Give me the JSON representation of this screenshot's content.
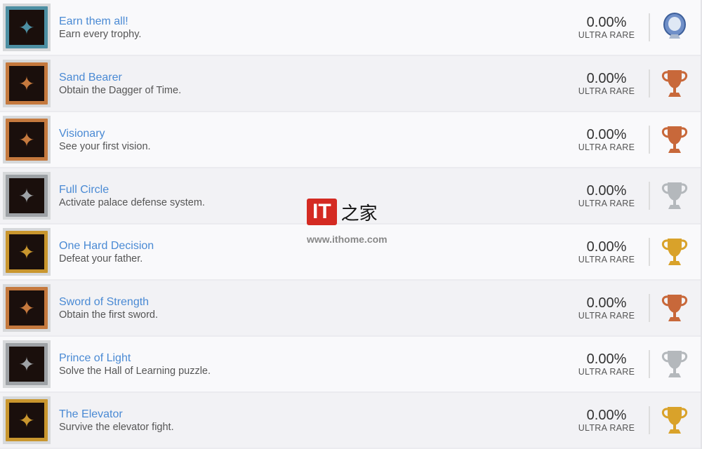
{
  "trophies": [
    {
      "title": "Earn them all!",
      "desc": "Earn every trophy.",
      "rarity": "0.00%",
      "rarity_label": "ULTRA RARE",
      "type": "platinum",
      "frame": "#4d8fa3"
    },
    {
      "title": "Sand Bearer",
      "desc": "Obtain the Dagger of Time.",
      "rarity": "0.00%",
      "rarity_label": "ULTRA RARE",
      "type": "bronze",
      "frame": "#c5793e"
    },
    {
      "title": "Visionary",
      "desc": "See your first vision.",
      "rarity": "0.00%",
      "rarity_label": "ULTRA RARE",
      "type": "bronze",
      "frame": "#c5793e"
    },
    {
      "title": "Full Circle",
      "desc": "Activate palace defense system.",
      "rarity": "0.00%",
      "rarity_label": "ULTRA RARE",
      "type": "silver",
      "frame": "#9ea2a6"
    },
    {
      "title": "One Hard Decision",
      "desc": "Defeat your father.",
      "rarity": "0.00%",
      "rarity_label": "ULTRA RARE",
      "type": "gold",
      "frame": "#c9962e"
    },
    {
      "title": "Sword of Strength",
      "desc": "Obtain the first sword.",
      "rarity": "0.00%",
      "rarity_label": "ULTRA RARE",
      "type": "bronze",
      "frame": "#c5793e"
    },
    {
      "title": "Prince of Light",
      "desc": "Solve the Hall of Learning puzzle.",
      "rarity": "0.00%",
      "rarity_label": "ULTRA RARE",
      "type": "silver",
      "frame": "#9ea2a6"
    },
    {
      "title": "The Elevator",
      "desc": "Survive the elevator fight.",
      "rarity": "0.00%",
      "rarity_label": "ULTRA RARE",
      "type": "gold",
      "frame": "#c9962e"
    }
  ],
  "trophy_colors": {
    "platinum": "#6f8fc8",
    "bronze": "#c8683a",
    "silver": "#b4b8bc",
    "gold": "#d9a22a"
  },
  "watermark": {
    "logo": "IT",
    "logo_cn": "之家",
    "url": "www.ithome.com"
  }
}
